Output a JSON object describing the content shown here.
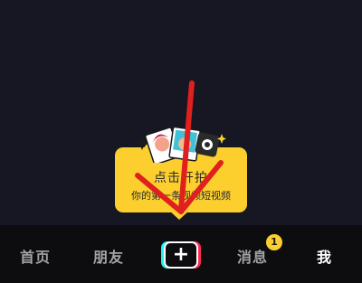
{
  "tooltip": {
    "title": "点击开拍",
    "subtitle": "你的第一条视频短视频"
  },
  "nav": {
    "home": "首页",
    "friends": "朋友",
    "create": "+",
    "messages": "消息",
    "messages_badge": "1",
    "me": "我"
  },
  "colors": {
    "background": "#161722",
    "nav_background": "#0d0d0f",
    "tooltip": "#fccf2f",
    "accent_cyan": "#25f4ee",
    "accent_red": "#fe2c55",
    "annotation_arrow": "#e0201e"
  },
  "icons": {
    "illustration": "cartoon-photos-camera-illustration",
    "annotation": "red-arrow-annotation"
  }
}
